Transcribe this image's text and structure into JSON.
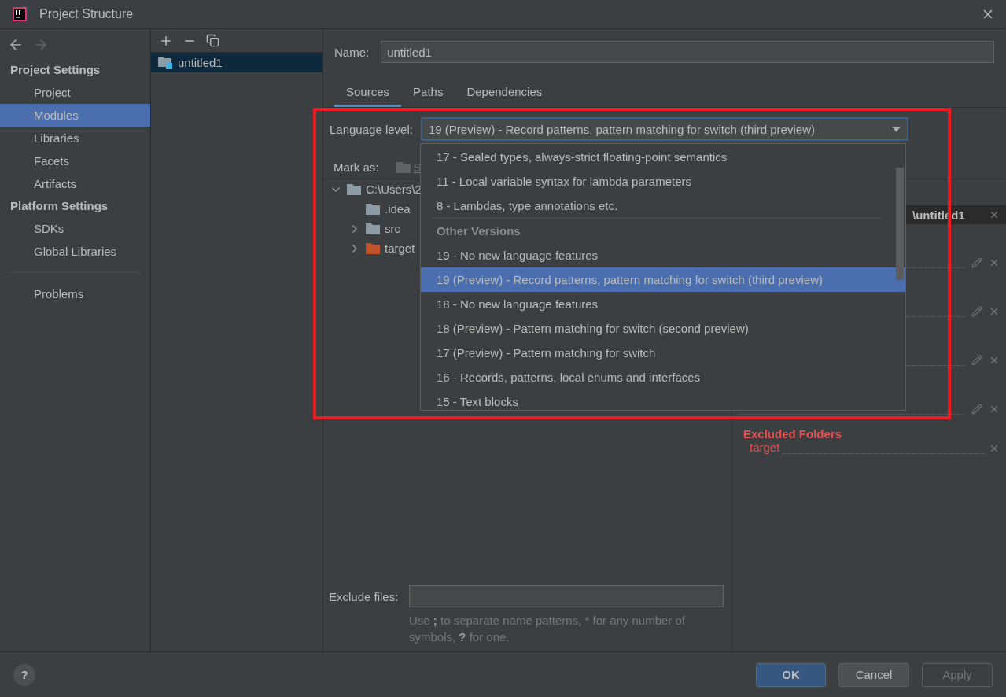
{
  "window": {
    "title": "Project Structure"
  },
  "sidebar": {
    "sections": [
      {
        "heading": "Project Settings",
        "items": [
          {
            "label": "Project",
            "selected": false
          },
          {
            "label": "Modules",
            "selected": true
          },
          {
            "label": "Libraries",
            "selected": false
          },
          {
            "label": "Facets",
            "selected": false
          },
          {
            "label": "Artifacts",
            "selected": false
          }
        ]
      },
      {
        "heading": "Platform Settings",
        "items": [
          {
            "label": "SDKs",
            "selected": false
          },
          {
            "label": "Global Libraries",
            "selected": false
          }
        ]
      }
    ],
    "footer_items": [
      {
        "label": "Problems",
        "selected": false
      }
    ]
  },
  "modules": [
    {
      "label": "untitled1",
      "selected": true
    }
  ],
  "name_field": {
    "label": "Name:",
    "value": "untitled1"
  },
  "tabs": [
    {
      "label": "Sources",
      "selected": true
    },
    {
      "label": "Paths",
      "selected": false
    },
    {
      "label": "Dependencies",
      "selected": false
    }
  ],
  "language_level": {
    "label": "Language level:",
    "value": "19 (Preview) - Record patterns, pattern matching for switch (third preview)",
    "options": [
      {
        "kind": "option",
        "label": "17 - Sealed types, always-strict floating-point semantics",
        "selected": false
      },
      {
        "kind": "option",
        "label": "11 - Local variable syntax for lambda parameters",
        "selected": false
      },
      {
        "kind": "option",
        "label": "8 - Lambdas, type annotations etc.",
        "selected": false
      },
      {
        "kind": "header",
        "label": "Other Versions"
      },
      {
        "kind": "option",
        "label": "19 - No new language features",
        "selected": false
      },
      {
        "kind": "option",
        "label": "19 (Preview) - Record patterns, pattern matching for switch (third preview)",
        "selected": true
      },
      {
        "kind": "option",
        "label": "18 - No new language features",
        "selected": false
      },
      {
        "kind": "option",
        "label": "18 (Preview) - Pattern matching for switch (second preview)",
        "selected": false
      },
      {
        "kind": "option",
        "label": "17 (Preview) - Pattern matching for switch",
        "selected": false
      },
      {
        "kind": "option",
        "label": "16 - Records, patterns, local enums and interfaces",
        "selected": false
      },
      {
        "kind": "option",
        "label": "15 - Text blocks",
        "selected": false
      }
    ]
  },
  "mark_as": {
    "label": "Mark as:",
    "buttons": [
      "S"
    ]
  },
  "tree": [
    {
      "label": "C:\\Users\\2",
      "expanded": true,
      "excluded": false,
      "children": [
        {
          "label": ".idea",
          "excluded": false
        },
        {
          "label": "src",
          "expanded": false,
          "excluded": false
        },
        {
          "label": "target",
          "expanded": false,
          "excluded": true
        }
      ]
    }
  ],
  "content_root": {
    "path": "\\untitled1",
    "excluded_heading": "Excluded Folders",
    "excluded_folders": [
      "target"
    ]
  },
  "exclude_files": {
    "label": "Exclude files:",
    "hint": "Use **;** to separate name patterns, * for any number of symbols, **?** for one."
  },
  "help_button": "?",
  "buttons": [
    {
      "label": "OK",
      "kind": "primary",
      "disabled": false
    },
    {
      "label": "Cancel",
      "kind": "normal",
      "disabled": false
    },
    {
      "label": "Apply",
      "kind": "normal",
      "disabled": true
    }
  ]
}
